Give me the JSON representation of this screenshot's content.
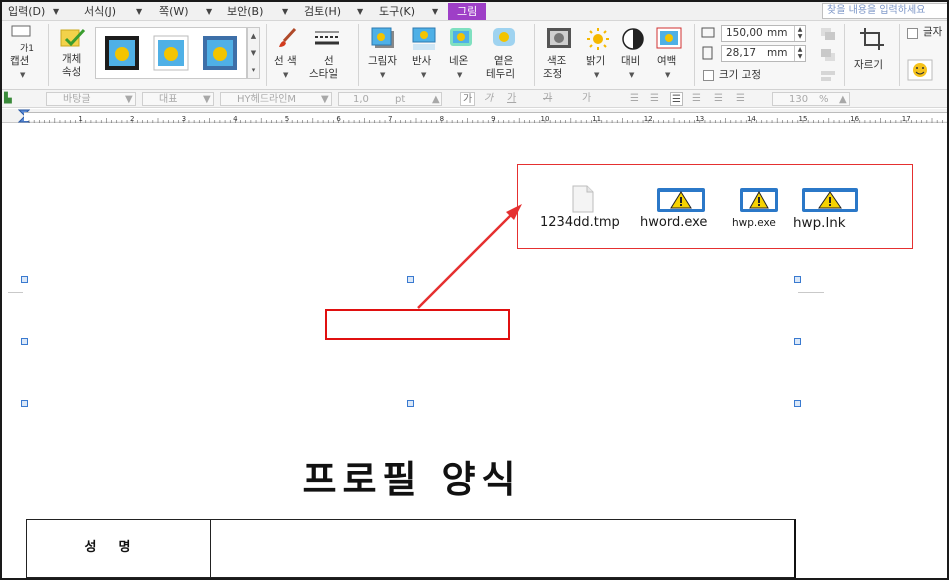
{
  "menu": {
    "items": [
      "입력(D)",
      "서식(J)",
      "쪽(W)",
      "보안(B)",
      "검토(H)",
      "도구(K)"
    ],
    "active_tab": "그림",
    "search_placeholder": "찾을 내용을 입력하세요"
  },
  "ribbon": {
    "caption_label": "캡션",
    "caption_icon_text": "가1",
    "object_props_label_1": "개체",
    "object_props_label_2": "속성",
    "line_color_label": "선 색",
    "line_style_label_1": "선",
    "line_style_label_2": "스타일",
    "shadow_label": "그림자",
    "reflection_label": "반사",
    "neon_label": "네온",
    "soft_edge_label_1": "옅은",
    "soft_edge_label_2": "테두리",
    "color_adjust_label_1": "색조",
    "color_adjust_label_2": "조정",
    "brightness_label": "밝기",
    "contrast_label": "대비",
    "margin_label": "여백",
    "width_value": "150,00",
    "height_value": "28,17",
    "unit_label": "mm",
    "fix_size_label": "크기 고정",
    "crop_label": "자르기",
    "text_wrap_label": "글자"
  },
  "formatbar": {
    "style_value": "바탕글",
    "representative_label": "대표",
    "font_value": "HY헤드라인M",
    "size_value": "1,0",
    "size_unit": "pt",
    "zoom_value": "130",
    "zoom_unit": "%",
    "bold_label": "가",
    "italic_label": "가",
    "underline_label": "가",
    "strike_label": "가",
    "super_label": "가"
  },
  "ruler": {
    "labels": [
      "1",
      "2",
      "3",
      "4",
      "5",
      "6",
      "7",
      "8",
      "9",
      "10",
      "11",
      "12",
      "13",
      "14",
      "15",
      "16",
      "17"
    ]
  },
  "document": {
    "files": [
      {
        "name": "1234dd.tmp",
        "icon": "blank-file-icon"
      },
      {
        "name": "hword.exe",
        "icon": "warning-window-icon"
      },
      {
        "name": "hwp.exe",
        "icon": "warning-window-icon"
      },
      {
        "name": "hwp.lnk",
        "icon": "warning-window-icon"
      }
    ],
    "title": "프로필 양식",
    "table_label": "성명"
  },
  "colors": {
    "accent": "#9e3fc7",
    "annotation": "#e53030",
    "handle": "#3a7ad0"
  }
}
